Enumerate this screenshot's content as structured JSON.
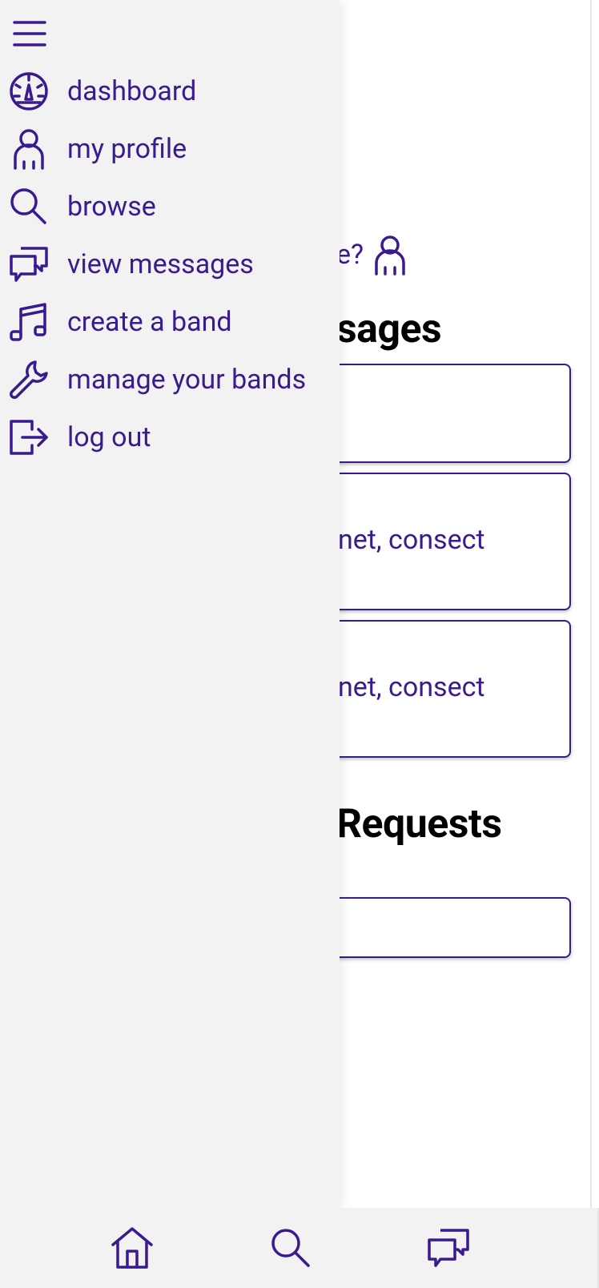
{
  "colors": {
    "accent": "#3a1a8f",
    "drawer_bg": "#f2f2f2",
    "page_bg": "#ffffff",
    "heading": "#000000"
  },
  "background": {
    "edit_prompt_visible": "e?",
    "messages_heading_visible": "sages",
    "requests_heading_visible": "Requests",
    "card_snippets": [
      "",
      "net, consect",
      "net, consect",
      ""
    ]
  },
  "drawer": {
    "menu_icon": "hamburger-icon",
    "items": [
      {
        "label": "dashboard",
        "icon": "gauge-icon"
      },
      {
        "label": "my profile",
        "icon": "person-icon"
      },
      {
        "label": "browse",
        "icon": "search-icon"
      },
      {
        "label": "view messages",
        "icon": "chat-bubbles-icon"
      },
      {
        "label": "create a band",
        "icon": "music-note-icon"
      },
      {
        "label": "manage your bands",
        "icon": "wrench-icon"
      },
      {
        "label": "log out",
        "icon": "logout-icon"
      }
    ]
  },
  "bottom_nav": [
    {
      "icon": "home-icon"
    },
    {
      "icon": "search-icon"
    },
    {
      "icon": "chat-bubbles-icon"
    }
  ]
}
